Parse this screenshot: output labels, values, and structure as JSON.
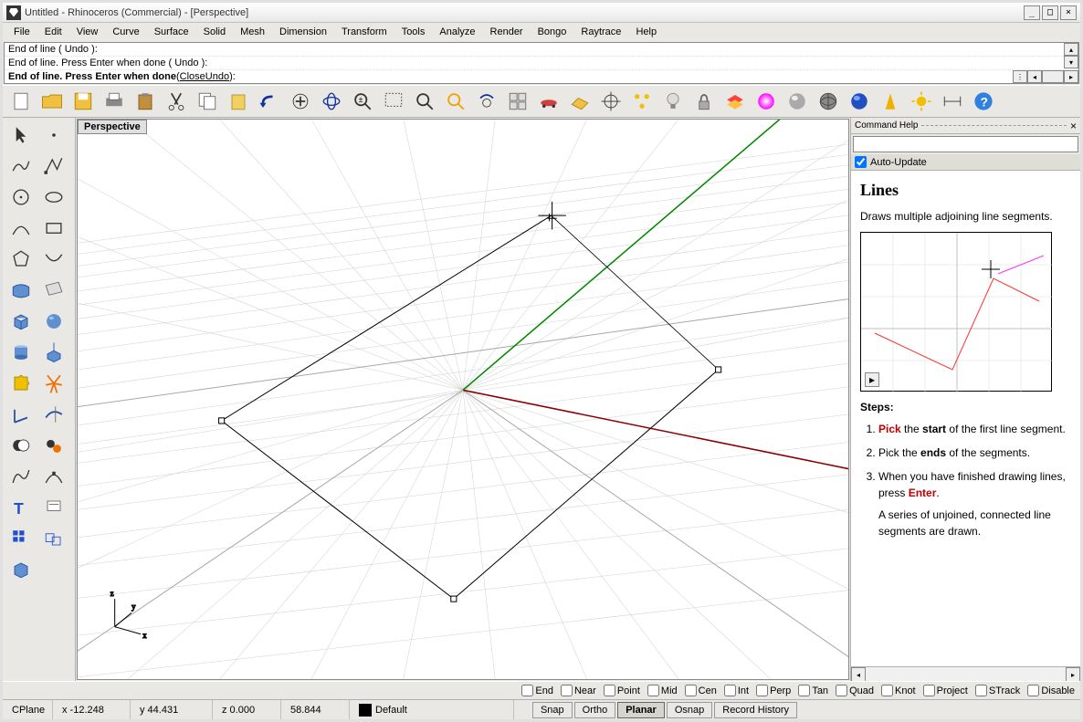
{
  "title": "Untitled - Rhinoceros (Commercial) - [Perspective]",
  "menus": [
    "File",
    "Edit",
    "View",
    "Curve",
    "Surface",
    "Solid",
    "Mesh",
    "Dimension",
    "Transform",
    "Tools",
    "Analyze",
    "Render",
    "Bongo",
    "Raytrace",
    "Help"
  ],
  "cmd": {
    "log1": "End of line ( Undo ):",
    "log2": "End of line. Press Enter when done ( Undo ):",
    "prompt_bold": "End of line. Press Enter when done",
    "prompt_rest_prefix": " ( ",
    "prompt_close": "Close",
    "prompt_sep": "  ",
    "prompt_undo": "Undo",
    "prompt_rest_suffix": " ): "
  },
  "viewport_label": "Perspective",
  "sidepanel": {
    "title": "Command Help",
    "auto": "Auto-Update",
    "heading": "Lines",
    "desc": "Draws multiple adjoining line segments.",
    "steps_label": "Steps:",
    "step1_a": "Pick",
    "step1_b": " the ",
    "step1_c": "start",
    "step1_d": " of the first line segment.",
    "step2_a": "Pick the ",
    "step2_b": "ends",
    "step2_c": " of the segments.",
    "step3_a": "When you have finished drawing lines, press ",
    "step3_b": "Enter",
    "step3_c": ".",
    "step3_note": "A series of unjoined, connected line segments are drawn."
  },
  "osnap": {
    "end": "End",
    "near": "Near",
    "point": "Point",
    "mid": "Mid",
    "cen": "Cen",
    "int": "Int",
    "perp": "Perp",
    "tan": "Tan",
    "quad": "Quad",
    "knot": "Knot",
    "project": "Project",
    "strack": "STrack",
    "disable": "Disable"
  },
  "status": {
    "cplane": "CPlane",
    "x": "x -12.248",
    "y": "y 44.431",
    "z": "z 0.000",
    "dist": "58.844",
    "layer": "Default",
    "snap": "Snap",
    "ortho": "Ortho",
    "planar": "Planar",
    "osnap": "Osnap",
    "record": "Record History"
  },
  "toolbar_main": [
    "new-file",
    "open-file",
    "save-file",
    "print",
    "paste",
    "cut",
    "copy",
    "clipboard",
    "undo",
    "redo-pan",
    "rotate-view",
    "zoom-extents",
    "zoom-window",
    "zoom-dynamic",
    "zoom-selected",
    "zoom-undo",
    "4view",
    "car-icon",
    "cplane-icon",
    "target-icon",
    "orient-icon",
    "bulb-icon",
    "lock-icon",
    "layers-icon",
    "materials-icon",
    "render-shaded",
    "render-wire",
    "render-blue",
    "flamingo-icon",
    "options-icon",
    "dim-icon",
    "help-icon"
  ],
  "toolbar_left": [
    [
      "pointer",
      "point"
    ],
    [
      "polyline",
      "single-line"
    ],
    [
      "circle",
      "circle-arc"
    ],
    [
      "arc",
      "rectangle"
    ],
    [
      "polygon",
      "curve"
    ],
    [
      "surface-patch",
      "surface-loft"
    ],
    [
      "box",
      "sphere"
    ],
    [
      "cylinder",
      "extrude"
    ],
    [
      "puzzle",
      "explode"
    ],
    [
      "dim-tool",
      "trim"
    ],
    [
      "boolean",
      "fillet"
    ],
    [
      "curve-fit",
      "curve-edit"
    ],
    [
      "text",
      "annotation"
    ],
    [
      "array",
      "group"
    ],
    [
      "hatch",
      "blank"
    ]
  ]
}
